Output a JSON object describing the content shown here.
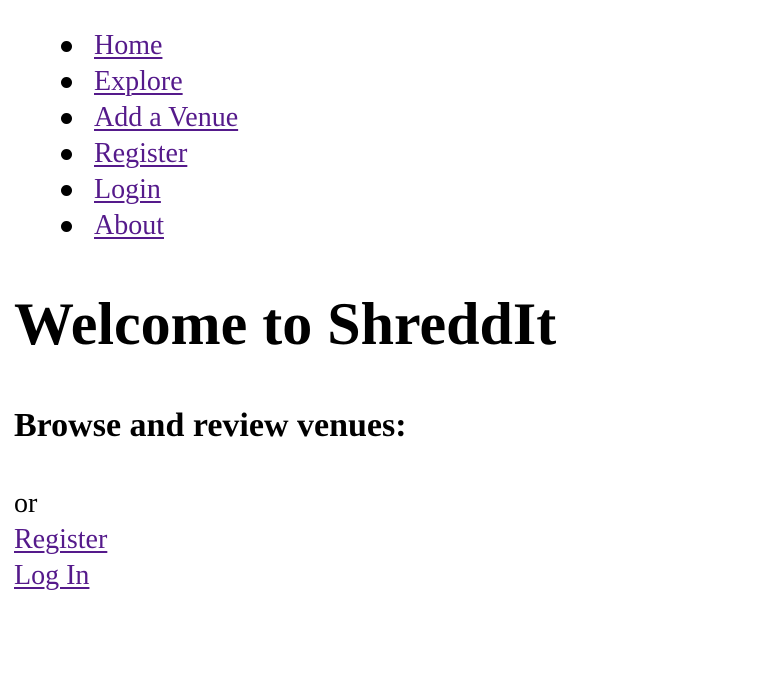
{
  "nav": {
    "items": [
      {
        "label": "Home"
      },
      {
        "label": "Explore"
      },
      {
        "label": "Add a Venue"
      },
      {
        "label": "Register"
      },
      {
        "label": "Login"
      },
      {
        "label": "About"
      }
    ]
  },
  "main": {
    "title": "Welcome to ShreddIt",
    "subtitle": "Browse and review venues:",
    "or_text": "or",
    "register_link": "Register",
    "login_link": "Log In"
  },
  "colors": {
    "link": "#551a8b",
    "text": "#000000",
    "background": "#ffffff"
  }
}
